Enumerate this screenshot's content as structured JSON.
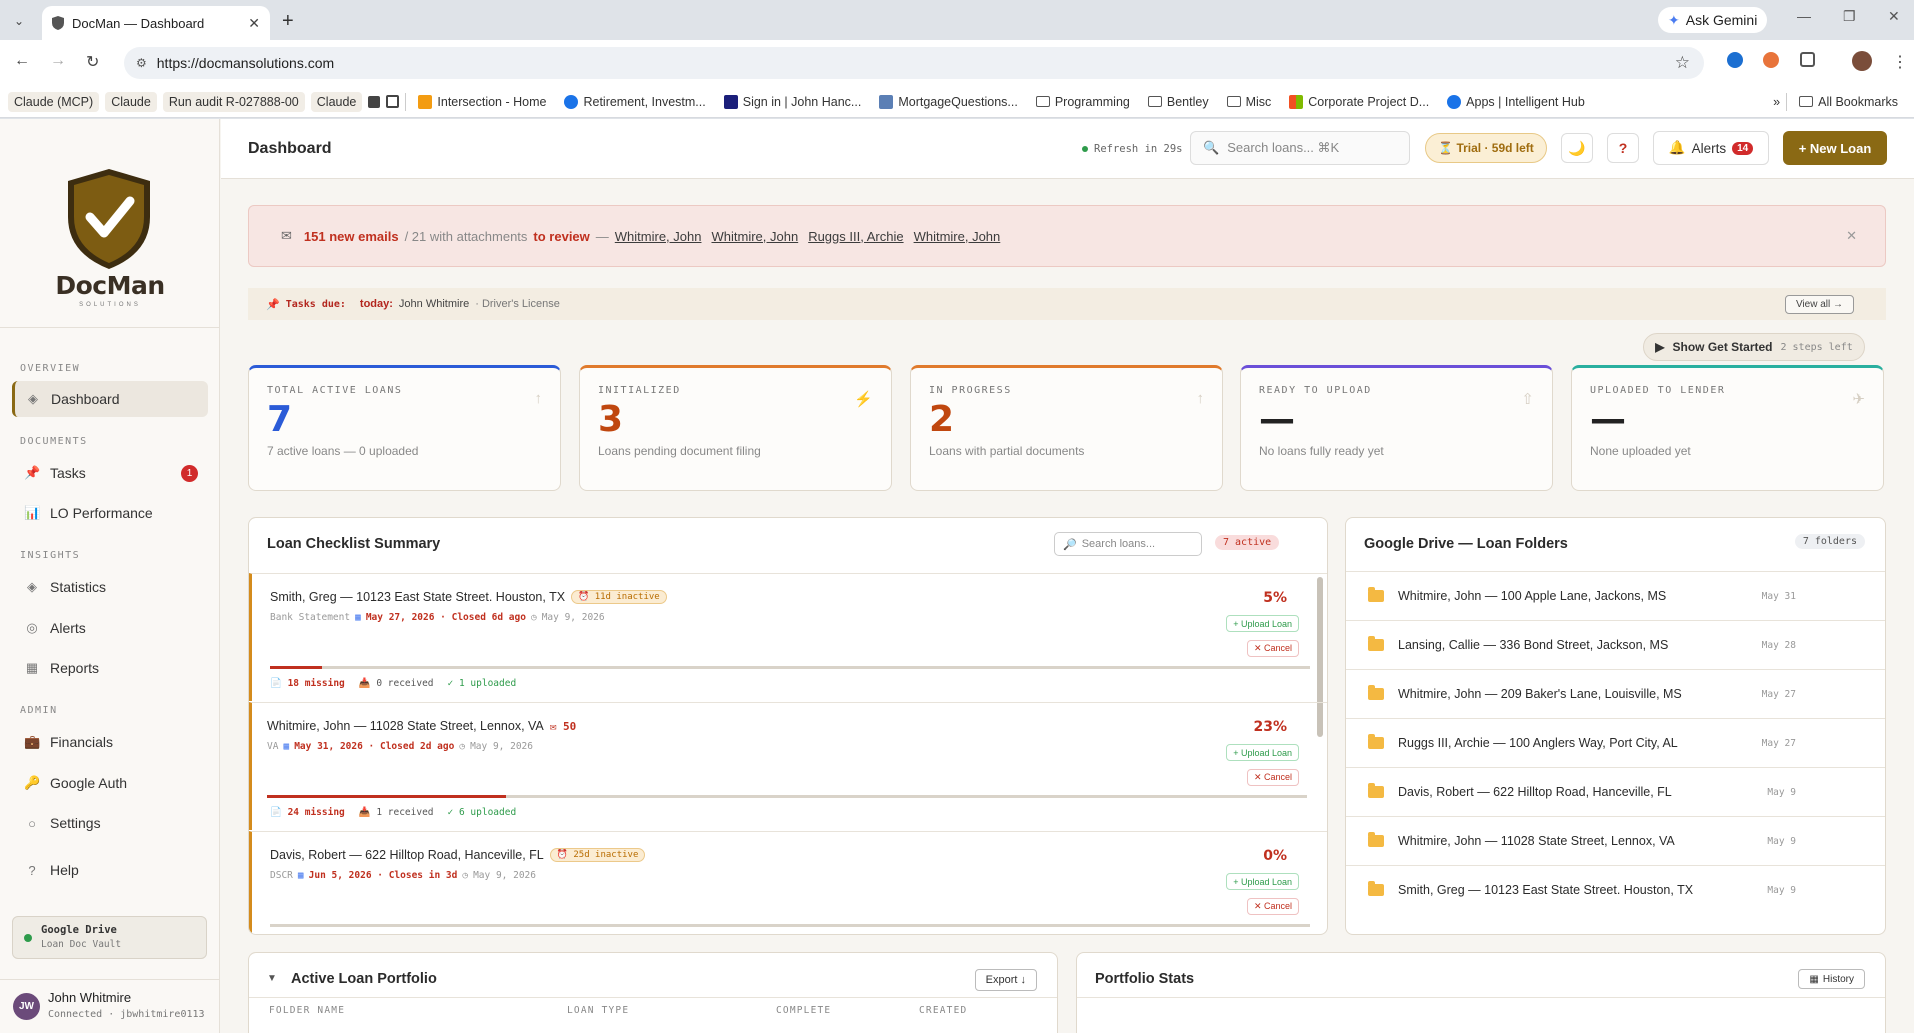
{
  "browser": {
    "tab_title": "DocMan — Dashboard",
    "url": "https://docmansolutions.com",
    "ask_gemini": "Ask Gemini",
    "bookmarks": [
      "Claude (MCP)",
      "Claude",
      "Run audit R-027888-00",
      "Claude",
      "Intersection - Home",
      "Retirement, Investm...",
      "Sign in | John Hanc...",
      "MortgageQuestions...",
      "Programming",
      "Bentley",
      "Misc",
      "Corporate Project D...",
      "Apps | Intelligent Hub"
    ],
    "all_bookmarks": "All Bookmarks"
  },
  "sidebar": {
    "logo_text": "DocMan",
    "logo_sub": "SOLUTIONS",
    "sections": {
      "overview": "OVERVIEW",
      "documents": "DOCUMENTS",
      "insights": "INSIGHTS",
      "admin": "ADMIN"
    },
    "items": {
      "dashboard": "Dashboard",
      "tasks": "Tasks",
      "tasks_badge": "1",
      "lo_performance": "LO Performance",
      "statistics": "Statistics",
      "alerts": "Alerts",
      "reports": "Reports",
      "financials": "Financials",
      "google_auth": "Google Auth",
      "settings": "Settings",
      "help": "Help"
    },
    "gdrive": {
      "title": "Google Drive",
      "sub": "Loan Doc Vault"
    },
    "user": {
      "initials": "JW",
      "name": "John Whitmire",
      "status": "Connected · jbwhitmire0113"
    }
  },
  "header": {
    "title": "Dashboard",
    "refresh": "Refresh in 29s",
    "search_placeholder": "Search loans... ⌘K",
    "trial": "⏳ Trial · 59d left",
    "alerts_label": "Alerts",
    "alerts_count": "14",
    "new_loan": "+ New Loan"
  },
  "email_alert": {
    "count": "151 new emails",
    "middle": "/ 21 with attachments",
    "review": "to review",
    "dash": "—",
    "names": [
      "Whitmire, John",
      "Whitmire, John",
      "Ruggs III, Archie",
      "Whitmire, John"
    ]
  },
  "tasks_due": {
    "label": "Tasks due:",
    "today": "today:",
    "name": "John Whitmire",
    "doc": "· Driver's License",
    "view_all": "View all →"
  },
  "get_started": {
    "label": "Show Get Started",
    "steps": "2 steps left"
  },
  "stats": [
    {
      "label": "TOTAL ACTIVE LOANS",
      "value": "7",
      "sub": "7 active loans — 0 uploaded",
      "color": "#2b5bd7",
      "icon": "↑"
    },
    {
      "label": "INITIALIZED",
      "value": "3",
      "sub": "Loans pending document filing",
      "color": "#c0470f",
      "icon": "⚡"
    },
    {
      "label": "IN PROGRESS",
      "value": "2",
      "sub": "Loans with partial documents",
      "color": "#c0470f",
      "icon": "↑"
    },
    {
      "label": "READY TO UPLOAD",
      "value": "—",
      "sub": "No loans fully ready yet",
      "color": "#222222",
      "icon": "⇧"
    },
    {
      "label": "UPLOADED TO LENDER",
      "value": "—",
      "sub": "None uploaded yet",
      "color": "#222222",
      "icon": "✈"
    }
  ],
  "loan_checklist": {
    "title": "Loan Checklist Summary",
    "search_placeholder": "Search loans...",
    "active": "7 active",
    "upload_label": "+ Upload Loan",
    "cancel_label": "✕ Cancel",
    "loans": [
      {
        "name": "Smith, Greg — 10123 East State Street. Houston, TX",
        "tag": "11d inactive",
        "type": "Bank Statement",
        "date": "May 27, 2026 · Closed 6d ago",
        "created": "May 9, 2026",
        "pct": "5%",
        "progress": 0.05,
        "missing": "18 missing",
        "received": "0 received",
        "uploaded": "✓ 1 uploaded"
      },
      {
        "name": "Whitmire, John — 11028 State Street, Lennox, VA",
        "tag": "50",
        "type": "VA",
        "date": "May 31, 2026 · Closed 2d ago",
        "created": "May 9, 2026",
        "pct": "23%",
        "progress": 0.23,
        "missing": "24 missing",
        "received": "1 received",
        "uploaded": "✓ 6 uploaded"
      },
      {
        "name": "Davis, Robert — 622 Hilltop Road, Hanceville, FL",
        "tag": "25d inactive",
        "type": "DSCR",
        "date": "Jun 5, 2026 · Closes in 3d",
        "created": "May 9, 2026",
        "pct": "0%",
        "progress": 0,
        "missing": "",
        "received": "",
        "uploaded": ""
      }
    ]
  },
  "drive_folders": {
    "title": "Google Drive — Loan Folders",
    "count": "7 folders",
    "folders": [
      {
        "name": "Whitmire, John — 100 Apple Lane, Jackons, MS",
        "date": "May 31"
      },
      {
        "name": "Lansing, Callie — 336 Bond Street, Jackson, MS",
        "date": "May 28"
      },
      {
        "name": "Whitmire, John — 209 Baker's Lane, Louisville, MS",
        "date": "May 27"
      },
      {
        "name": "Ruggs III, Archie — 100 Anglers Way, Port City, AL",
        "date": "May 27"
      },
      {
        "name": "Davis, Robert — 622 Hilltop Road, Hanceville, FL",
        "date": "May 9"
      },
      {
        "name": "Whitmire, John — 11028 State Street, Lennox, VA",
        "date": "May 9"
      },
      {
        "name": "Smith, Greg — 10123 East State Street. Houston, TX",
        "date": "May 9"
      }
    ]
  },
  "portfolio": {
    "title": "Active Loan Portfolio",
    "export": "Export ↓",
    "columns": [
      "FOLDER NAME",
      "LOAN TYPE",
      "COMPLETE",
      "CREATED"
    ]
  },
  "portfolio_stats": {
    "title": "Portfolio Stats",
    "history": "History"
  }
}
